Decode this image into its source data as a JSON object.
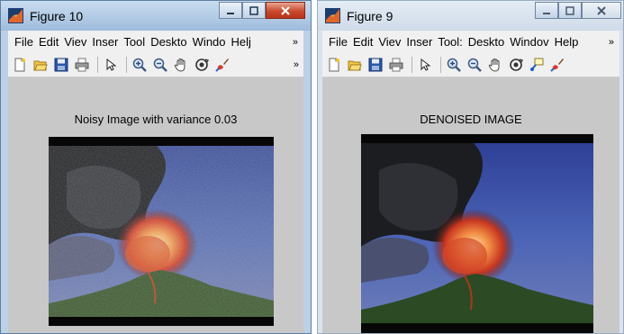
{
  "windows": {
    "left": {
      "title": "Figure 10",
      "menu": [
        "File",
        "Edit",
        "Viev",
        "Inser",
        "Tool",
        "Deskto",
        "Windo",
        "Helj"
      ],
      "menu_more": "»",
      "toolbar_more": "»",
      "figure_title": "Noisy Image with variance 0.03",
      "active": true
    },
    "right": {
      "title": "Figure 9",
      "menu": [
        "File",
        "Edit",
        "Viev",
        "Inser",
        "Tool:",
        "Deskto",
        "Windov",
        "Help"
      ],
      "menu_more": "»",
      "figure_title": "DENOISED IMAGE",
      "active": false
    }
  },
  "colors": {
    "active_title": "#b3cbe6",
    "inactive_title": "#dbe5f0",
    "close_active": "#c94a2f",
    "figure_bg": "#c8c8c8"
  },
  "icons": {
    "app": "matlab-logo-icon",
    "toolbar": [
      "new-file-icon",
      "open-folder-icon",
      "save-icon",
      "print-icon",
      "pointer-arrow-icon",
      "zoom-in-icon",
      "zoom-out-icon",
      "pan-hand-icon",
      "rotate-3d-icon",
      "data-cursor-icon",
      "brush-icon"
    ]
  }
}
